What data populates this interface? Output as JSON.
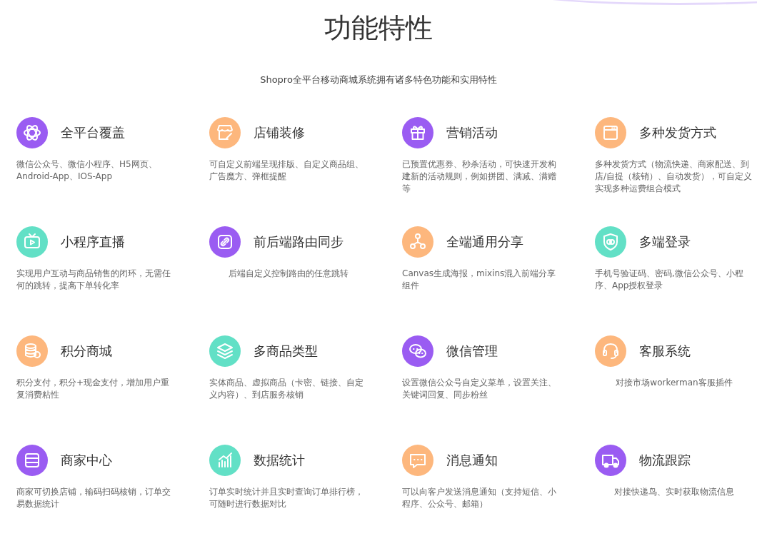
{
  "title": "功能特性",
  "subtitle": "Shopro全平台移动商城系统拥有诸多特色功能和实用特性",
  "features": [
    {
      "kind": "atom",
      "color": "#9a5cf2",
      "title": "全平台覆盖",
      "description": "微信公众号、微信小程序、H5网页、Android-App、IOS-App",
      "centered": false
    },
    {
      "kind": "shop",
      "color": "#fdb77d",
      "title": "店铺装修",
      "description": "可自定义前端呈现排版、自定义商品组、广告魔方、弹框提醒",
      "centered": false
    },
    {
      "kind": "gift",
      "color": "#9a5cf2",
      "title": "营销活动",
      "description": "已预置优惠券、秒杀活动，可快速开发构建新的活动规则，例如拼团、满减、满赠等",
      "centered": false
    },
    {
      "kind": "window",
      "color": "#fdb77d",
      "title": "多种发货方式",
      "description": "多种发货方式（物流快递、商家配送、到店/自提（核销）、自动发货），可自定义实现多种运费组合模式",
      "centered": false
    },
    {
      "kind": "tv",
      "color": "#62e0c6",
      "title": "小程序直播",
      "description": "实现用户互动与商品销售的闭环，无需任何的跳转，提高下单转化率",
      "centered": false
    },
    {
      "kind": "link",
      "color": "#9a5cf2",
      "title": "前后端路由同步",
      "description": "后端自定义控制路由的任意跳转",
      "centered": true
    },
    {
      "kind": "share",
      "color": "#fdb77d",
      "title": "全端通用分享",
      "description": "Canvas生成海报，mixins混入前端分享组件",
      "centered": false
    },
    {
      "kind": "shield",
      "color": "#62e0c6",
      "title": "多端登录",
      "description": "手机号验证码、密码,微信公众号、小程序、App授权登录",
      "centered": false
    },
    {
      "kind": "coins",
      "color": "#fdb77d",
      "title": "积分商城",
      "description": "积分支付，积分+现金支付，增加用户重复消费粘性",
      "centered": false
    },
    {
      "kind": "layers",
      "color": "#62e0c6",
      "title": "多商品类型",
      "description": "实体商品、虚拟商品（卡密、链接、自定义内容）、到店服务核销",
      "centered": false
    },
    {
      "kind": "chat",
      "color": "#9a5cf2",
      "title": "微信管理",
      "description": "设置微信公众号自定义菜单，设置关注、关键词回复、同步粉丝",
      "centered": false
    },
    {
      "kind": "headset",
      "color": "#fdb77d",
      "title": "客服系统",
      "description": "对接市场workerman客服插件",
      "centered": true
    },
    {
      "kind": "card",
      "color": "#9a5cf2",
      "title": "商家中心",
      "description": "商家可切换店铺，输码扫码核销，订单交易数据统计",
      "centered": false
    },
    {
      "kind": "chart",
      "color": "#62e0c6",
      "title": "数据统计",
      "description": "订单实时统计并且实时查询订单排行榜，可随时进行数据对比",
      "centered": false
    },
    {
      "kind": "message",
      "color": "#fdb77d",
      "title": "消息通知",
      "description": "可以向客户发送消息通知（支持短信、小程序、公众号、邮箱）",
      "centered": false
    },
    {
      "kind": "truck",
      "color": "#9a5cf2",
      "title": "物流跟踪",
      "description": "对接快递鸟、实时获取物流信息",
      "centered": true
    }
  ]
}
